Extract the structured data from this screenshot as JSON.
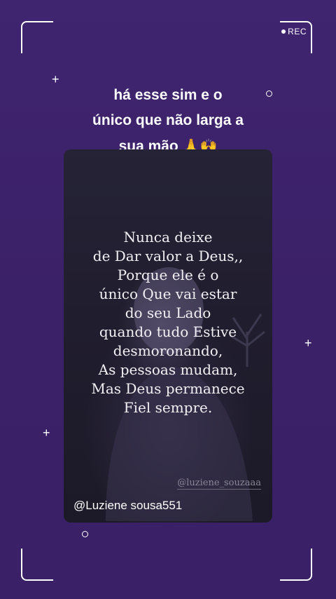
{
  "status": {
    "rec_label": "REC"
  },
  "caption": {
    "text": "há  esse  sim  e o\núnico que não  larga  a\nsua mão",
    "emoji": "🙏🙌"
  },
  "card": {
    "quote_lines": [
      "Nunca deixe",
      "de Dar valor a Deus,,",
      "Porque ele é o",
      "único Que vai estar",
      "do seu Lado",
      "quando tudo Estive",
      "desmoronando,",
      "As pessoas mudam,",
      "Mas Deus permanece",
      "Fiel sempre."
    ],
    "watermark": "@luziene_souzaaa",
    "handle": "@Luziene sousa551"
  },
  "colors": {
    "background": "#3c2269",
    "frame": "#ffffff",
    "card": "#211e30",
    "emoji": "#f2b233"
  }
}
